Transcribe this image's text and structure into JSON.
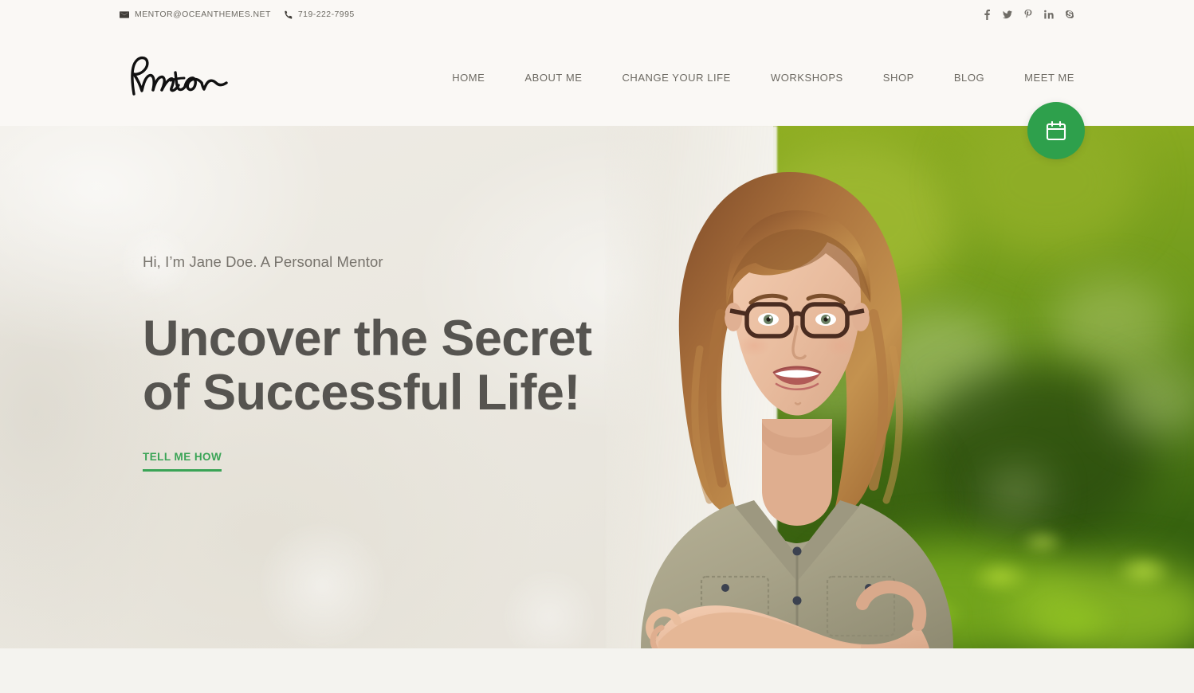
{
  "topbar": {
    "email": "MENTOR@OCEANTHEMES.NET",
    "email_icon": "envelope-icon",
    "phone": "719-222-7995",
    "phone_icon": "phone-icon",
    "social": [
      {
        "name": "facebook",
        "label": "f"
      },
      {
        "name": "twitter",
        "label": "t"
      },
      {
        "name": "pinterest",
        "label": "p"
      },
      {
        "name": "linkedin",
        "label": "in"
      },
      {
        "name": "skype",
        "label": "s"
      }
    ]
  },
  "header": {
    "logo_text": "Mentor",
    "nav": [
      {
        "label": "HOME"
      },
      {
        "label": "ABOUT ME"
      },
      {
        "label": "CHANGE YOUR LIFE"
      },
      {
        "label": "WORKSHOPS"
      },
      {
        "label": "SHOP"
      },
      {
        "label": "BLOG"
      },
      {
        "label": "MEET ME"
      }
    ]
  },
  "hero": {
    "subtitle": "Hi, I’m Jane Doe. A Personal Mentor",
    "title_line1": "Uncover the Secret",
    "title_line2": "of Successful Life!",
    "cta_label": "TELL ME HOW",
    "portrait_alt": "smiling-woman-with-glasses-arms-crossed"
  },
  "floating_button": {
    "icon": "calendar-icon",
    "aria_label": "Book an appointment"
  },
  "colors": {
    "accent_green": "#3aa456",
    "button_green": "#2ea04c",
    "header_bg": "#faf8f5",
    "hero_left_bg": "#eae7df",
    "heading_text": "#565450",
    "body_text": "#6d6a63",
    "below_bg": "#f4f3ef"
  }
}
